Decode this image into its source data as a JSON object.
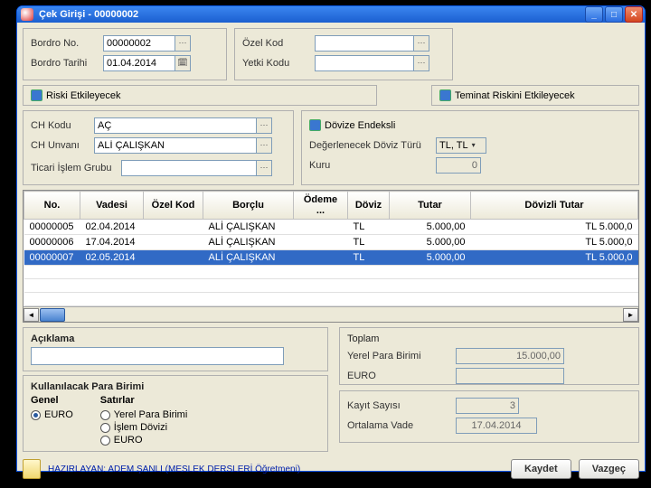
{
  "window": {
    "title": "Çek Girişi - 00000002"
  },
  "header": {
    "bordro_no_label": "Bordro No.",
    "bordro_no": "00000002",
    "bordro_tarihi_label": "Bordro Tarihi",
    "bordro_tarihi": "01.04.2014",
    "ozel_kod_label": "Özel Kod",
    "ozel_kod": "",
    "yetki_kodu_label": "Yetki Kodu",
    "yetki_kodu": ""
  },
  "checks": {
    "riski_label": "Riski Etkileyecek",
    "teminat_label": "Teminat Riskini Etkileyecek"
  },
  "ch": {
    "kodu_label": "CH Kodu",
    "kodu": "AÇ",
    "unvani_label": "CH Unvanı",
    "unvani": "ALİ ÇALIŞKAN",
    "ticari_label": "Ticari İşlem Grubu",
    "ticari": ""
  },
  "doviz": {
    "endeksli_label": "Dövize Endeksli",
    "deger_label": "Değerlenecek Döviz Türü",
    "deger_value": "TL, TL",
    "kuru_label": "Kuru",
    "kuru": "0"
  },
  "table": {
    "cols": {
      "no": "No.",
      "vadesi": "Vadesi",
      "ozel": "Özel Kod",
      "borclu": "Borçlu",
      "odeme": "Ödeme ...",
      "doviz": "Döviz",
      "tutar": "Tutar",
      "dovizli": "Dövizli Tutar"
    },
    "rows": [
      {
        "no": "00000005",
        "vadesi": "02.04.2014",
        "ozel": "",
        "borclu": "ALİ ÇALIŞKAN",
        "odeme": "",
        "doviz": "TL",
        "tutar": "5.000,00",
        "dovizli": "TL 5.000,0"
      },
      {
        "no": "00000006",
        "vadesi": "17.04.2014",
        "ozel": "",
        "borclu": "ALİ ÇALIŞKAN",
        "odeme": "",
        "doviz": "TL",
        "tutar": "5.000,00",
        "dovizli": "TL 5.000,0"
      },
      {
        "no": "00000007",
        "vadesi": "02.05.2014",
        "ozel": "",
        "borclu": "ALİ ÇALIŞKAN",
        "odeme": "",
        "doviz": "TL",
        "tutar": "5.000,00",
        "dovizli": "TL 5.000,0"
      }
    ]
  },
  "aciklama": {
    "label": "Açıklama",
    "value": ""
  },
  "para": {
    "legend": "Kullanılacak Para Birimi",
    "genel_label": "Genel",
    "genel_euro": "EURO",
    "satirlar_label": "Satırlar",
    "s_yerel": "Yerel Para Birimi",
    "s_islem": "İşlem Dövizi",
    "s_euro": "EURO"
  },
  "totals": {
    "toplam_label": "Toplam",
    "yerel_label": "Yerel Para Birimi",
    "yerel": "15.000,00",
    "euro_label": "EURO",
    "euro": "",
    "kayit_label": "Kayıt Sayısı",
    "kayit": "3",
    "ortalama_label": "Ortalama Vade",
    "ortalama": "17.04.2014"
  },
  "footer": {
    "credit": "HAZIRLAYAN: ADEM ŞANLI (MESLEK DERSLERİ Öğretmeni)",
    "save": "Kaydet",
    "cancel": "Vazgeç"
  }
}
